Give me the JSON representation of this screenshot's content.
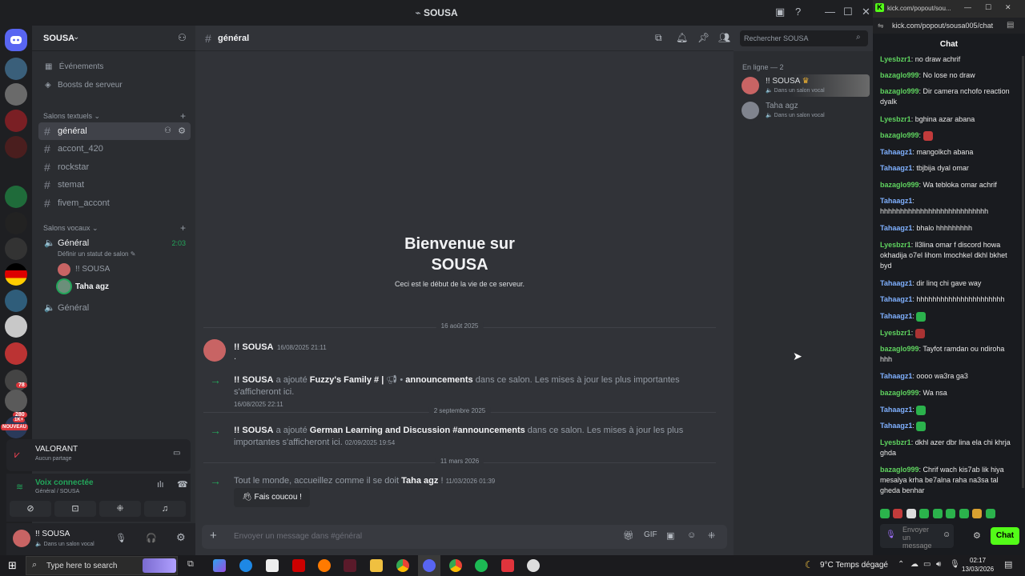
{
  "window": {
    "title": "SOUSA"
  },
  "server": {
    "name": "SOUSA"
  },
  "sidebar": {
    "events": "Événements",
    "boosts": "Boosts de serveur",
    "text_category": "Salons textuels",
    "voice_category": "Salons vocaux",
    "text_channels": [
      "général",
      "accont_420",
      "rockstar",
      "stemat",
      "fivem_accont"
    ],
    "voice_channel": "Général",
    "voice_timer": "2:03",
    "voice_status": "Définir un statut de salon",
    "voice_users": [
      "!! SOUSA",
      "Taha agz"
    ],
    "voice_channel_2": "Général"
  },
  "guild_badges": {
    "b1": "78",
    "b2": "280",
    "new": "NOUVEAU",
    "b3": "1K+"
  },
  "activity": {
    "game": "VALORANT",
    "game_sub": "Aucun partage",
    "voice": "Voix connectée",
    "voice_sub": "Général / SOUSA"
  },
  "user": {
    "name": "!! SOUSA",
    "status": "Dans un salon vocal"
  },
  "header": {
    "channel": "général",
    "search_placeholder": "Rechercher SOUSA"
  },
  "welcome": {
    "title_line1": "Bienvenue sur",
    "title_line2": "SOUSA",
    "subtitle": "Ceci est le début de la vie de ce serveur."
  },
  "messages": {
    "date1": "16 août 2025",
    "m1_author": "!! SOUSA",
    "m1_ts": "16/08/2025 21:11",
    "m1_text": ".",
    "s1_author": "!! SOUSA",
    "s1_added": "a ajouté",
    "s1_target": "Fuzzy's Family # |",
    "s1_channel": "announcements",
    "s1_rest": "dans ce salon. Les mises à jour les plus importantes s'afficheront ici.",
    "s1_ts": "16/08/2025 22:11",
    "date2": "2 septembre 2025",
    "s2_author": "!! SOUSA",
    "s2_added": "a ajouté",
    "s2_target": "German Learning and Discussion #announcements",
    "s2_rest": "dans ce salon. Les mises à jour les plus importantes s'afficheront ici.",
    "s2_ts": "02/09/2025 19:54",
    "date3": "11 mars 2026",
    "s3_text": "Tout le monde, accueillez comme il se doit",
    "s3_name": "Taha agz",
    "s3_end": "!",
    "s3_ts": "11/03/2026 01:39",
    "wave": "Fais coucou !"
  },
  "composer": {
    "placeholder": "Envoyer un message dans #général"
  },
  "members": {
    "heading": "En ligne — 2",
    "list": [
      {
        "name": "!! SOUSA",
        "status": "Dans un salon vocal"
      },
      {
        "name": "Taha agz",
        "status": "Dans un salon vocal"
      }
    ]
  },
  "popout": {
    "tab_title": "kick.com/popout/sou...",
    "url": "kick.com/popout/sousa005/chat",
    "heading": "Chat",
    "messages": [
      {
        "user": "Lyesbzr1",
        "color": "#5fd35f",
        "text": "no draw achrif"
      },
      {
        "user": "bazaglo999",
        "color": "#5fd35f",
        "text": "No lose no draw"
      },
      {
        "user": "bazaglo999",
        "color": "#5fd35f",
        "text": "Dir camera nchofo reaction dyalk"
      },
      {
        "user": "Lyesbzr1",
        "color": "#5fd35f",
        "text": "bghina azar abana"
      },
      {
        "user": "bazaglo999",
        "color": "#5fd35f",
        "text": ""
      },
      {
        "user": "Tahaagz1",
        "color": "#7fb0ff",
        "text": "mangolkch abana"
      },
      {
        "user": "Tahaagz1",
        "color": "#7fb0ff",
        "text": "tbjbija dyal omar"
      },
      {
        "user": "bazaglo999",
        "color": "#5fd35f",
        "text": "Wa tebloka omar achrif"
      },
      {
        "user": "Tahaagz1",
        "color": "#7fb0ff",
        "text": "hhhhhhhhhhhhhhhhhhhhhhhhhhh"
      },
      {
        "user": "Tahaagz1",
        "color": "#7fb0ff",
        "text": "bhalo hhhhhhhhh"
      },
      {
        "user": "Lyesbzr1",
        "color": "#5fd35f",
        "text": "ll3lina omar f discord howa okhadija o7el lihom lmochkel dkhl bkhet byd"
      },
      {
        "user": "Tahaagz1",
        "color": "#7fb0ff",
        "text": "dir linq chi gave way"
      },
      {
        "user": "Tahaagz1",
        "color": "#7fb0ff",
        "text": "hhhhhhhhhhhhhhhhhhhhhh"
      },
      {
        "user": "Tahaagz1",
        "color": "#7fb0ff",
        "text": ""
      },
      {
        "user": "Lyesbzr1",
        "color": "#5fd35f",
        "text": ""
      },
      {
        "user": "bazaglo999",
        "color": "#5fd35f",
        "text": "Tayfot ramdan ou ndiroha hhh"
      },
      {
        "user": "Tahaagz1",
        "color": "#7fb0ff",
        "text": "oooo wa3ra ga3"
      },
      {
        "user": "bazaglo999",
        "color": "#5fd35f",
        "text": "Wa nsa"
      },
      {
        "user": "Tahaagz1",
        "color": "#7fb0ff",
        "text": ""
      },
      {
        "user": "Tahaagz1",
        "color": "#7fb0ff",
        "text": ""
      },
      {
        "user": "Lyesbzr1",
        "color": "#5fd35f",
        "text": "dkhl azer dbr lina ela chi khrja ghda"
      },
      {
        "user": "bazaglo999",
        "color": "#5fd35f",
        "text": "Chrif wach kis7ab lik hiya mesalya krha be7alna raha na3sa tal gheda benhar"
      }
    ],
    "input_placeholder": "Envoyer un message",
    "send": "Chat"
  },
  "taskbar": {
    "search": "Type here to search",
    "weather": "9°C  Temps dégagé",
    "time": "02:17",
    "date": "13/03/2026"
  }
}
